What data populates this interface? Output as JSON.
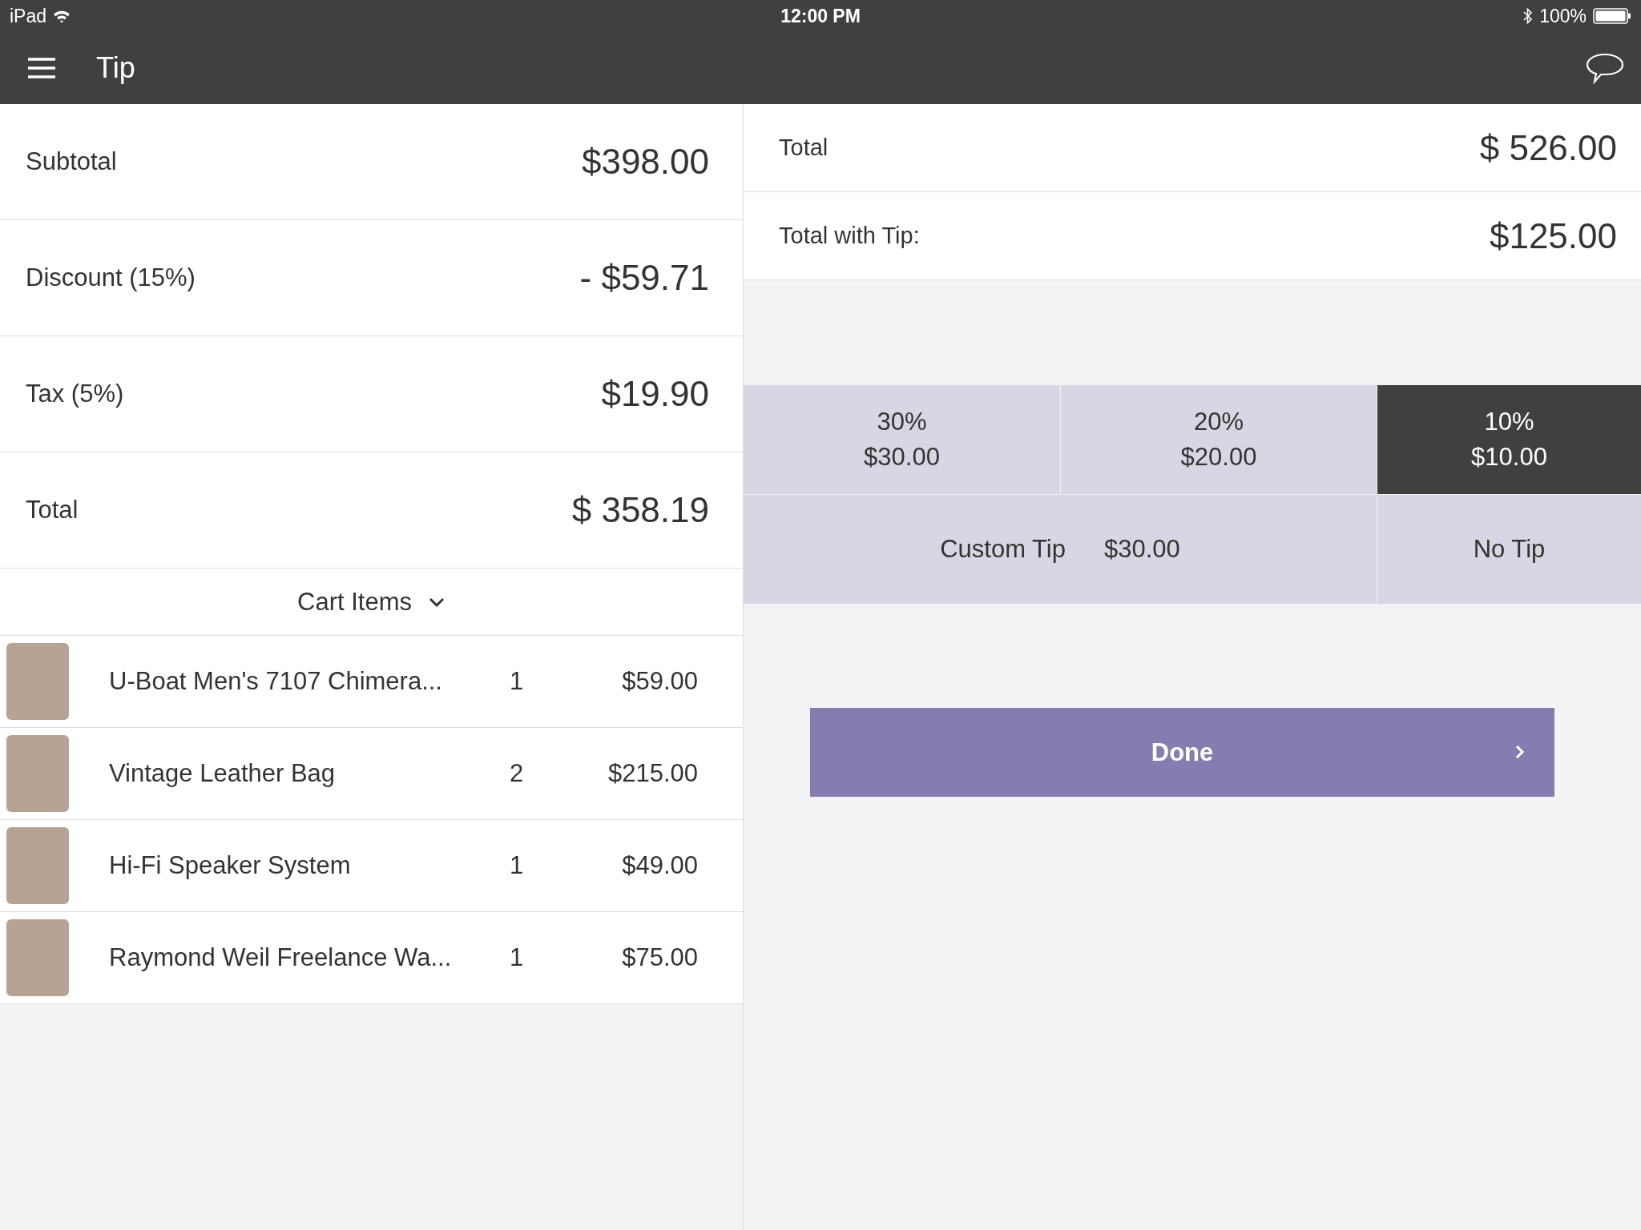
{
  "status_bar": {
    "device": "iPad",
    "time": "12:00 PM",
    "battery": "100%"
  },
  "nav": {
    "title": "Tip"
  },
  "summary": [
    {
      "label": "Subtotal",
      "value": "$398.00"
    },
    {
      "label": "Discount (15%)",
      "value": "- $59.71"
    },
    {
      "label": "Tax (5%)",
      "value": "$19.90"
    },
    {
      "label": "Total",
      "value": "$ 358.19"
    }
  ],
  "cart": {
    "header": "Cart Items",
    "expanded": true,
    "items": [
      {
        "name": "U-Boat Men's 7107 Chimera...",
        "qty": "1",
        "price": "$59.00"
      },
      {
        "name": "Vintage Leather Bag",
        "qty": "2",
        "price": "$215.00"
      },
      {
        "name": "Hi-Fi Speaker System",
        "qty": "1",
        "price": "$49.00"
      },
      {
        "name": "Raymond Weil Freelance Wa...",
        "qty": "1",
        "price": "$75.00"
      }
    ]
  },
  "totals": [
    {
      "label": "Total",
      "value": "$ 526.00"
    },
    {
      "label": "Total with Tip:",
      "value": "$125.00"
    }
  ],
  "tip_options": [
    {
      "percent": "30%",
      "amount": "$30.00",
      "selected": false
    },
    {
      "percent": "20%",
      "amount": "$20.00",
      "selected": false
    },
    {
      "percent": "10%",
      "amount": "$10.00",
      "selected": true
    }
  ],
  "custom_tip": {
    "label": "Custom Tip",
    "amount": "$30.00",
    "selected": false
  },
  "no_tip": {
    "label": "No Tip",
    "selected": false
  },
  "done_button": {
    "label": "Done"
  }
}
